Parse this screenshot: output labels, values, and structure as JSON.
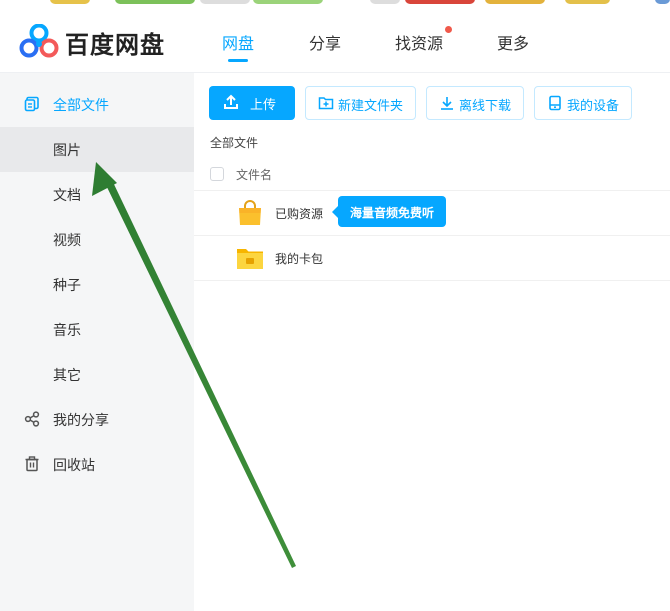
{
  "app": {
    "title": "百度网盘",
    "accent_color": "#06a7ff"
  },
  "nav": {
    "items": [
      {
        "label": "网盘",
        "active": true
      },
      {
        "label": "分享",
        "active": false
      },
      {
        "label": "找资源",
        "active": false,
        "badge": "red-dot"
      },
      {
        "label": "更多",
        "active": false
      }
    ]
  },
  "sidebar": {
    "items": [
      {
        "label": "全部文件",
        "icon": "files-icon",
        "state": "active"
      },
      {
        "label": "图片",
        "state": "hover"
      },
      {
        "label": "文档"
      },
      {
        "label": "视频"
      },
      {
        "label": "种子"
      },
      {
        "label": "音乐"
      },
      {
        "label": "其它"
      },
      {
        "label": "我的分享",
        "icon": "share-icon"
      },
      {
        "label": "回收站",
        "icon": "trash-icon"
      }
    ]
  },
  "toolbar": {
    "upload": {
      "label": "上传",
      "icon": "upload-icon"
    },
    "new_folder": {
      "label": "新建文件夹",
      "icon": "new-folder-icon"
    },
    "offline_download": {
      "label": "离线下载",
      "icon": "download-icon"
    },
    "my_devices": {
      "label": "我的设备",
      "icon": "device-icon"
    }
  },
  "breadcrumb": "全部文件",
  "file_list": {
    "column_name": "文件名",
    "rows": [
      {
        "name": "已购资源",
        "icon": "shopping-bag-icon"
      },
      {
        "name": "我的卡包",
        "icon": "wallet-folder-icon"
      }
    ]
  },
  "tooltip": {
    "text": "海量音频免费听"
  },
  "annotation": {
    "type": "arrow",
    "color": "#2e7d32"
  }
}
